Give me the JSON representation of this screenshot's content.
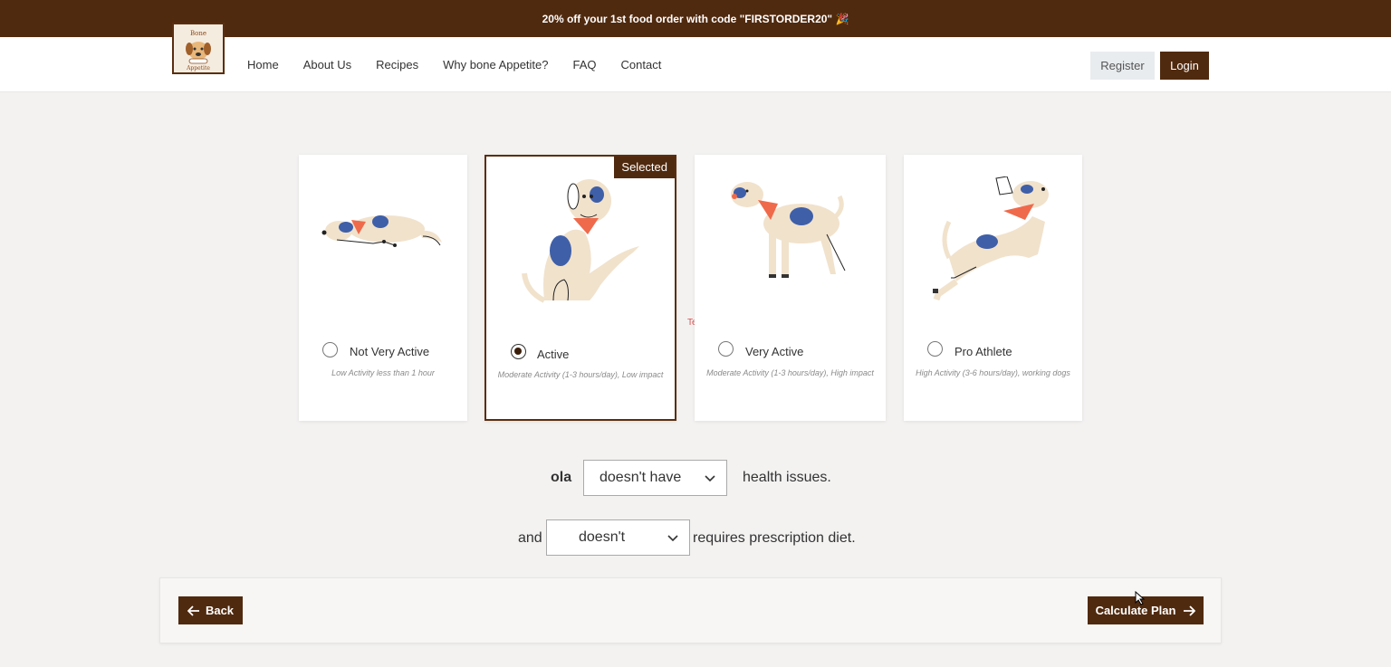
{
  "promo": {
    "text": "20% off your 1st food order with code \"FIRSTORDER20\" 🎉"
  },
  "logo": {
    "top": "Bone",
    "bottom": "Appetite"
  },
  "nav": {
    "links": [
      "Home",
      "About Us",
      "Recipes",
      "Why bone Appetite?",
      "FAQ",
      "Contact"
    ],
    "register_label": "Register",
    "login_label": "Login"
  },
  "activity": {
    "selected_badge": "Selected",
    "options": [
      {
        "title": "Not Very Active",
        "desc": "Low Activity less than 1 hour",
        "checked": false
      },
      {
        "title": "Active",
        "desc": "Moderate Activity (1-3 hours/day), Low impact",
        "checked": true
      },
      {
        "title": "Very Active",
        "desc": "Moderate Activity (1-3 hours/day), High impact",
        "checked": false
      },
      {
        "title": "Pro Athlete",
        "desc": "High Activity (3-6 hours/day), working dogs",
        "checked": false
      }
    ]
  },
  "stray_text": "Text",
  "health": {
    "dog_name": "ola",
    "select_value": "doesn't have",
    "suffix": "health issues."
  },
  "diet": {
    "prefix": "and",
    "select_value": "doesn't",
    "suffix": "requires prescription diet."
  },
  "footer": {
    "back_label": "Back",
    "calc_label": "Calculate Plan"
  },
  "colors": {
    "brand_brown": "#502a0f",
    "dog_body": "#f1e2cc",
    "spot_blue": "#3f5fa8",
    "bandana": "#ef6a4b"
  }
}
